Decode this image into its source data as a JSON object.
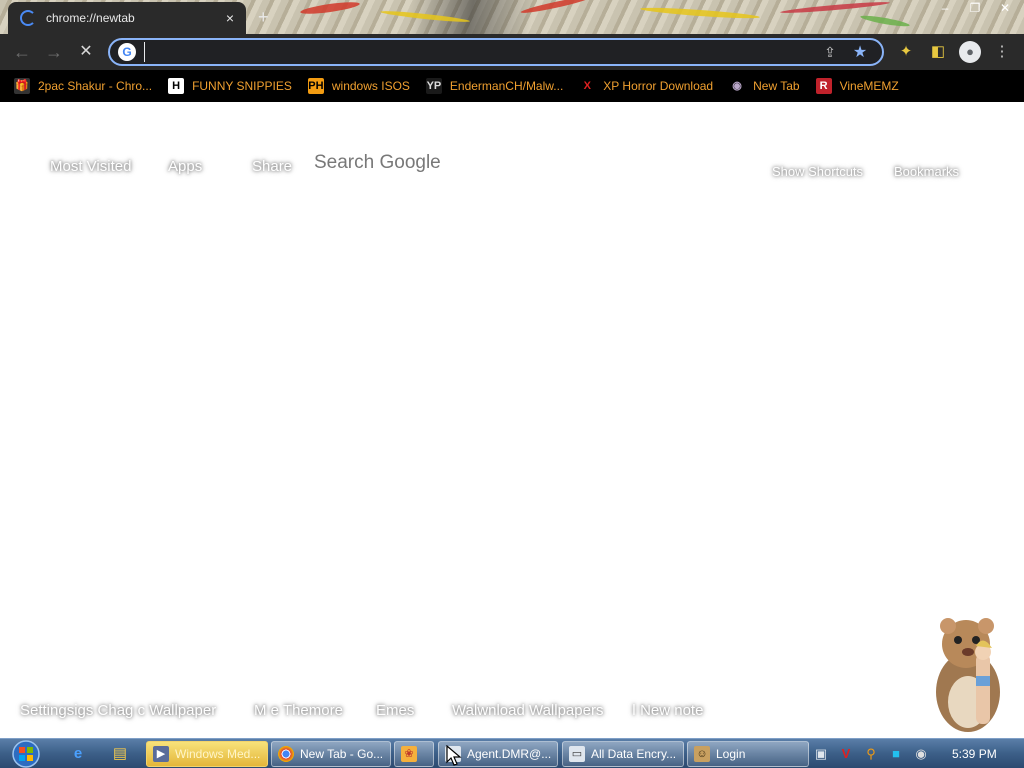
{
  "browser": {
    "tab": {
      "title": "chrome://newtab",
      "close_icon": "×"
    },
    "new_tab_icon": "+",
    "window_controls": [
      "–",
      "❐",
      "✕"
    ],
    "omnibox": {
      "value": "",
      "placeholder": ""
    },
    "bookmarks": [
      {
        "label": "2pac Shakur - Chro...",
        "icon": "gift-icon",
        "icon_text": "🎁",
        "fav_bg": "#333333",
        "fav_color": "#ffffff"
      },
      {
        "label": "FUNNY SNIPPIES",
        "icon": "h-logo-icon",
        "icon_text": "H",
        "fav_bg": "#ffffff",
        "fav_color": "#000000"
      },
      {
        "label": "windows ISOS",
        "icon": "ph-logo-icon",
        "icon_text": "PH",
        "fav_bg": "#f39c12",
        "fav_color": "#000000"
      },
      {
        "label": "EndermanCH/Malw...",
        "icon": "yp-logo-icon",
        "icon_text": "YP",
        "fav_bg": "#1a1a1a",
        "fav_color": "#dddddd"
      },
      {
        "label": "XP Horror Download",
        "icon": "x-logo-icon",
        "icon_text": "X",
        "fav_bg": "#000000",
        "fav_color": "#e02020"
      },
      {
        "label": "New Tab",
        "icon": "globe-icon",
        "icon_text": "◉",
        "fav_bg": "#000000",
        "fav_color": "#b9a7c9"
      },
      {
        "label": "VineMEMZ",
        "icon": "r-logo-icon",
        "icon_text": "R",
        "fav_bg": "#c0222b",
        "fav_color": "#ffffff"
      }
    ]
  },
  "newtab": {
    "links_left": [
      "Most Visited",
      "Apps",
      "Share"
    ],
    "search_text": "Search Google",
    "links_right": [
      "Show Shortcuts",
      "Bookmarks"
    ],
    "footer_links": [
      "Settingsigs Chag c Wallpaper",
      "M e Themore",
      "Emes",
      "Walwnload Wallpapers",
      "ǀ New note"
    ]
  },
  "taskbar": {
    "tasks": [
      {
        "label": "Windows Med...",
        "icon": "media-player-icon",
        "highlighted": true
      },
      {
        "label": "New Tab - Go...",
        "icon": "chrome-icon",
        "highlighted": false
      },
      {
        "label": "",
        "icon": "app-icon",
        "highlighted": false
      },
      {
        "label": "Agent.DMR@...",
        "icon": "window-icon",
        "highlighted": false
      },
      {
        "label": "All Data Encry...",
        "icon": "window-icon",
        "highlighted": false
      },
      {
        "label": "Login",
        "icon": "user-icon",
        "highlighted": false
      }
    ],
    "clock": "5:39 PM"
  },
  "colors": {
    "bookmark_text": "#f0a030",
    "toolbar_bg": "#2a2a2a",
    "omnibox_border": "#8ab4f8",
    "taskbar_highlight": "#e4b63a"
  }
}
